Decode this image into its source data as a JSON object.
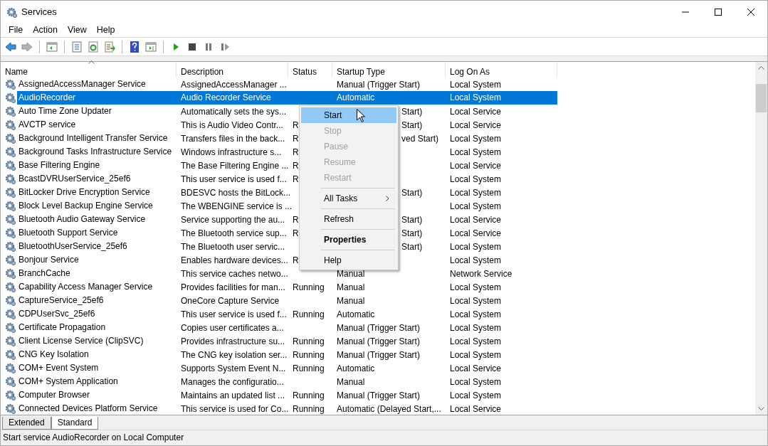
{
  "window": {
    "title": "Services"
  },
  "menu": [
    "File",
    "Action",
    "View",
    "Help"
  ],
  "toolbar": [
    {
      "kind": "back"
    },
    {
      "kind": "forward",
      "disabled": true
    },
    {
      "kind": "sep"
    },
    {
      "kind": "tree"
    },
    {
      "kind": "sep"
    },
    {
      "kind": "props"
    },
    {
      "kind": "refresh"
    },
    {
      "kind": "export"
    },
    {
      "kind": "sep"
    },
    {
      "kind": "help"
    },
    {
      "kind": "pane"
    },
    {
      "kind": "sep"
    },
    {
      "kind": "play"
    },
    {
      "kind": "stop"
    },
    {
      "kind": "pause"
    },
    {
      "kind": "resume"
    }
  ],
  "table": {
    "columns": [
      {
        "label": "Name",
        "sorted": true
      },
      {
        "label": "Description",
        "sorted": false
      },
      {
        "label": "Status",
        "sorted": false
      },
      {
        "label": "Startup Type",
        "sorted": false
      },
      {
        "label": "Log On As",
        "sorted": false
      }
    ],
    "rows": [
      {
        "name": "AssignedAccessManager Service",
        "description": "AssignedAccessManager ...",
        "status": "",
        "startup": "Manual (Trigger Start)",
        "logon": "Local System",
        "selected": false,
        "under_menu": false
      },
      {
        "name": "AudioRecorder",
        "description": "Audio Recorder Service",
        "status": "",
        "startup": "Automatic",
        "logon": "Local System",
        "selected": true,
        "under_menu": false
      },
      {
        "name": "Auto Time Zone Updater",
        "description": "Automatically sets the sys...",
        "status": "",
        "startup": "Start)",
        "logon": "Local Service",
        "selected": false,
        "under_menu": true
      },
      {
        "name": "AVCTP service",
        "description": "This is Audio Video Contr...",
        "status": "R",
        "startup": "Start)",
        "logon": "Local Service",
        "selected": false,
        "under_menu": true
      },
      {
        "name": "Background Intelligent Transfer Service",
        "description": "Transfers files in the back...",
        "status": "R",
        "startup": "ved Start)",
        "logon": "Local System",
        "selected": false,
        "under_menu": true
      },
      {
        "name": "Background Tasks Infrastructure Service",
        "description": "Windows infrastructure s...",
        "status": "R",
        "startup": "",
        "logon": "Local System",
        "selected": false
      },
      {
        "name": "Base Filtering Engine",
        "description": "The Base Filtering Engine ...",
        "status": "R",
        "startup": "",
        "logon": "Local Service",
        "selected": false
      },
      {
        "name": "BcastDVRUserService_25ef6",
        "description": "This user service is used f...",
        "status": "R",
        "startup": "",
        "logon": "Local System",
        "selected": false
      },
      {
        "name": "BitLocker Drive Encryption Service",
        "description": "BDESVC hosts the BitLock...",
        "status": "",
        "startup": "Start)",
        "logon": "Local System",
        "selected": false,
        "under_menu": true
      },
      {
        "name": "Block Level Backup Engine Service",
        "description": "The WBENGINE service is ...",
        "status": "",
        "startup": "",
        "logon": "Local System",
        "selected": false
      },
      {
        "name": "Bluetooth Audio Gateway Service",
        "description": "Service supporting the au...",
        "status": "R",
        "startup": "Start)",
        "logon": "Local Service",
        "selected": false,
        "under_menu": true
      },
      {
        "name": "Bluetooth Support Service",
        "description": "The Bluetooth service sup...",
        "status": "R",
        "startup": "Start)",
        "logon": "Local Service",
        "selected": false,
        "under_menu": true
      },
      {
        "name": "BluetoothUserService_25ef6",
        "description": "The Bluetooth user servic...",
        "status": "",
        "startup": "Start)",
        "logon": "Local System",
        "selected": false,
        "under_menu": true
      },
      {
        "name": "Bonjour Service",
        "description": "Enables hardware devices...",
        "status": "R",
        "startup": "",
        "logon": "Local System",
        "selected": false
      },
      {
        "name": "BranchCache",
        "description": "This service caches netwo...",
        "status": "",
        "startup": "Manual",
        "logon": "Network Service",
        "selected": false,
        "under_menu": false
      },
      {
        "name": "Capability Access Manager Service",
        "description": "Provides facilities for man...",
        "status": "Running",
        "startup": "Manual",
        "logon": "Local System",
        "selected": false,
        "under_menu": false
      },
      {
        "name": "CaptureService_25ef6",
        "description": "OneCore Capture Service",
        "status": "",
        "startup": "Manual",
        "logon": "Local System",
        "selected": false,
        "under_menu": false
      },
      {
        "name": "CDPUserSvc_25ef6",
        "description": "This user service is used f...",
        "status": "Running",
        "startup": "Automatic",
        "logon": "Local System",
        "selected": false,
        "under_menu": false
      },
      {
        "name": "Certificate Propagation",
        "description": "Copies user certificates a...",
        "status": "",
        "startup": "Manual (Trigger Start)",
        "logon": "Local System",
        "selected": false,
        "under_menu": false
      },
      {
        "name": "Client License Service (ClipSVC)",
        "description": "Provides infrastructure su...",
        "status": "Running",
        "startup": "Manual (Trigger Start)",
        "logon": "Local System",
        "selected": false,
        "under_menu": false
      },
      {
        "name": "CNG Key Isolation",
        "description": "The CNG key isolation ser...",
        "status": "Running",
        "startup": "Manual (Trigger Start)",
        "logon": "Local System",
        "selected": false,
        "under_menu": false
      },
      {
        "name": "COM+ Event System",
        "description": "Supports System Event N...",
        "status": "Running",
        "startup": "Automatic",
        "logon": "Local Service",
        "selected": false,
        "under_menu": false
      },
      {
        "name": "COM+ System Application",
        "description": "Manages the configuratio...",
        "status": "",
        "startup": "Manual",
        "logon": "Local System",
        "selected": false,
        "under_menu": false
      },
      {
        "name": "Computer Browser",
        "description": "Maintains an updated list ...",
        "status": "Running",
        "startup": "Manual (Trigger Start)",
        "logon": "Local System",
        "selected": false,
        "under_menu": false
      },
      {
        "name": "Connected Devices Platform Service",
        "description": "This service is used for Co...",
        "status": "Running",
        "startup": "Automatic (Delayed Start,...",
        "logon": "Local Service",
        "selected": false,
        "under_menu": false
      }
    ]
  },
  "context_menu": [
    {
      "kind": "item",
      "label": "Start",
      "selected": true,
      "disabled": false
    },
    {
      "kind": "item",
      "label": "Stop",
      "selected": false,
      "disabled": true
    },
    {
      "kind": "item",
      "label": "Pause",
      "selected": false,
      "disabled": true
    },
    {
      "kind": "item",
      "label": "Resume",
      "selected": false,
      "disabled": true
    },
    {
      "kind": "item",
      "label": "Restart",
      "selected": false,
      "disabled": true
    },
    {
      "kind": "separator"
    },
    {
      "kind": "submenu",
      "label": "All Tasks",
      "selected": false,
      "disabled": false
    },
    {
      "kind": "separator"
    },
    {
      "kind": "item",
      "label": "Refresh",
      "selected": false,
      "disabled": false
    },
    {
      "kind": "separator"
    },
    {
      "kind": "default",
      "label": "Properties",
      "selected": false,
      "disabled": false
    },
    {
      "kind": "separator"
    },
    {
      "kind": "item",
      "label": "Help",
      "selected": false,
      "disabled": false
    }
  ],
  "tabs": [
    {
      "label": "Extended",
      "selected": false
    },
    {
      "label": "Standard",
      "selected": true
    }
  ],
  "status_bar": "Start service AudioRecorder on Local Computer"
}
